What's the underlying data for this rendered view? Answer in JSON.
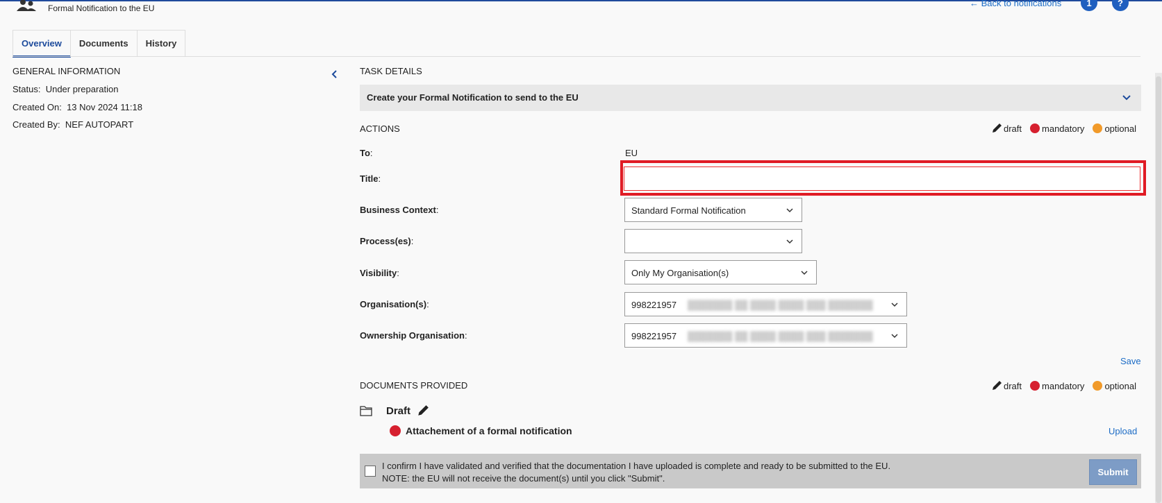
{
  "header": {
    "subtitle": "Formal Notification to the EU",
    "back_link": "Back to notifications",
    "info_badge": "1",
    "help_badge": "?"
  },
  "tabs": [
    {
      "label": "Overview",
      "active": true
    },
    {
      "label": "Documents",
      "active": false
    },
    {
      "label": "History",
      "active": false
    }
  ],
  "general": {
    "title": "GENERAL INFORMATION",
    "status_label": "Status:",
    "status_value": "Under preparation",
    "created_on_label": "Created On:",
    "created_on_value": "13 Nov 2024 11:18",
    "created_by_label": "Created By:",
    "created_by_value": "NEF AUTOPART"
  },
  "task": {
    "section_title": "TASK DETAILS",
    "bar_text": "Create your Formal Notification to send to the EU"
  },
  "legend": {
    "draft": "draft",
    "mandatory": "mandatory",
    "optional": "optional"
  },
  "actions": {
    "section_title": "ACTIONS",
    "to_label": "To",
    "to_value": "EU",
    "title_label": "Title",
    "title_value": "",
    "business_context_label": "Business Context",
    "business_context_value": "Standard Formal Notification",
    "processes_label": "Process(es)",
    "processes_value": "",
    "visibility_label": "Visibility",
    "visibility_value": "Only My Organisation(s)",
    "organisations_label": "Organisation(s)",
    "organisations_value": "998221957",
    "ownership_label": "Ownership Organisation",
    "ownership_value": "998221957",
    "save_label": "Save",
    "colon": ":"
  },
  "documents": {
    "section_title": "DOCUMENTS PROVIDED",
    "folder_title": "Draft",
    "attachment": "Attachement of a formal notification",
    "upload_label": "Upload"
  },
  "confirm": {
    "line1": "I confirm I have validated and verified that the documentation I have uploaded is complete and ready to be submitted to the EU.",
    "line2": "NOTE: the EU will not receive the document(s) until you click \"Submit\".",
    "submit_label": "Submit"
  },
  "colors": {
    "accent": "#1d4b9c",
    "link": "#1c6cc6",
    "mandatory": "#d6202f",
    "optional": "#f19a2a",
    "highlight": "#e01b24"
  }
}
